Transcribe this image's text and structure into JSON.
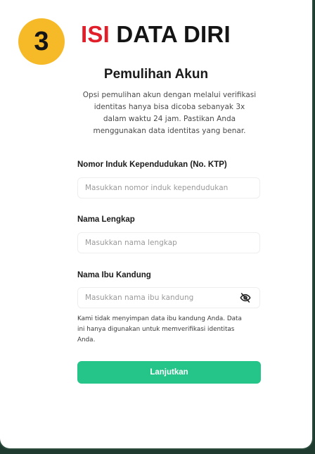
{
  "banner": {
    "step_number": "3",
    "title_accent": "ISI",
    "title_rest": " DATA DIRI"
  },
  "page": {
    "title": "Pemulihan Akun",
    "subtitle_lines": [
      "Opsi pemulihan akun dengan melalui verifikasi",
      "identitas hanya bisa dicoba sebanyak 3x",
      "dalam waktu 24 jam. Pastikan Anda",
      "menggunakan data identitas yang benar."
    ]
  },
  "form": {
    "nik": {
      "label": "Nomor Induk Kependudukan (No. KTP)",
      "placeholder": "Masukkan nomor induk kependudukan",
      "value": ""
    },
    "full_name": {
      "label": "Nama Lengkap",
      "placeholder": "Masukkan nama lengkap",
      "value": ""
    },
    "mother_name": {
      "label": "Nama Ibu Kandung",
      "placeholder": "Masukkan nama ibu kandung",
      "value": ""
    },
    "helper_lines": [
      "Kami tidak menyimpan data ibu kandung Anda. Data",
      "ini hanya digunakan untuk memverifikasi identitas",
      "Anda."
    ],
    "submit_label": "Lanjutkan"
  },
  "icons": {
    "toggle_visibility": "eye-off-icon"
  },
  "colors": {
    "step_badge": "#f6b928",
    "accent_red": "#e01f2a",
    "primary_green": "#25c489"
  }
}
